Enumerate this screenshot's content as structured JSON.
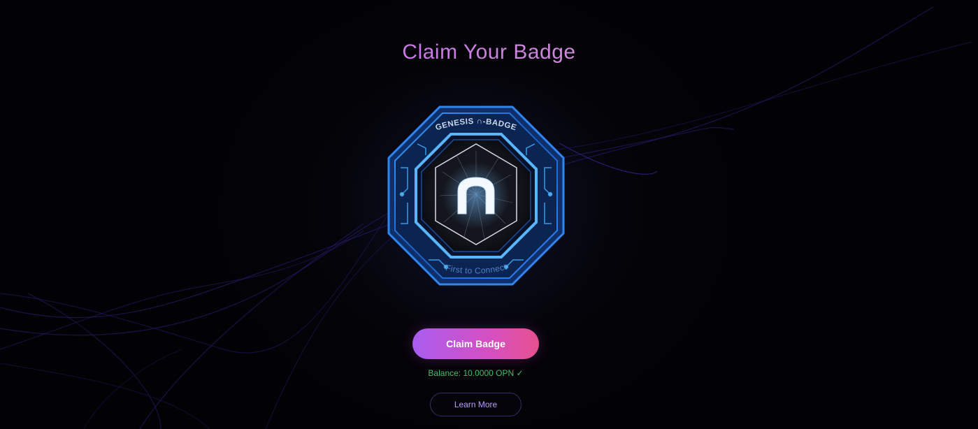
{
  "page": {
    "title": "Claim Your Badge"
  },
  "badge": {
    "top_text": "GENESIS ∩-BADGE",
    "bottom_text": "First to Connect",
    "emblem_icon": "n-logo-icon"
  },
  "actions": {
    "claim_label": "Claim Badge",
    "learn_more_label": "Learn More"
  },
  "status": {
    "balance_text": "Balance: 10.0000 OPN ✓"
  },
  "colors": {
    "background": "#030207",
    "title_gradient": [
      "#c777e8",
      "#d08bd9"
    ],
    "claim_gradient": [
      "#a95df0",
      "#d44fc2",
      "#e6508f"
    ],
    "balance": "#3fbf6a",
    "badge_blue": "#1f7ae8",
    "learn_border": "#3c2a63"
  }
}
